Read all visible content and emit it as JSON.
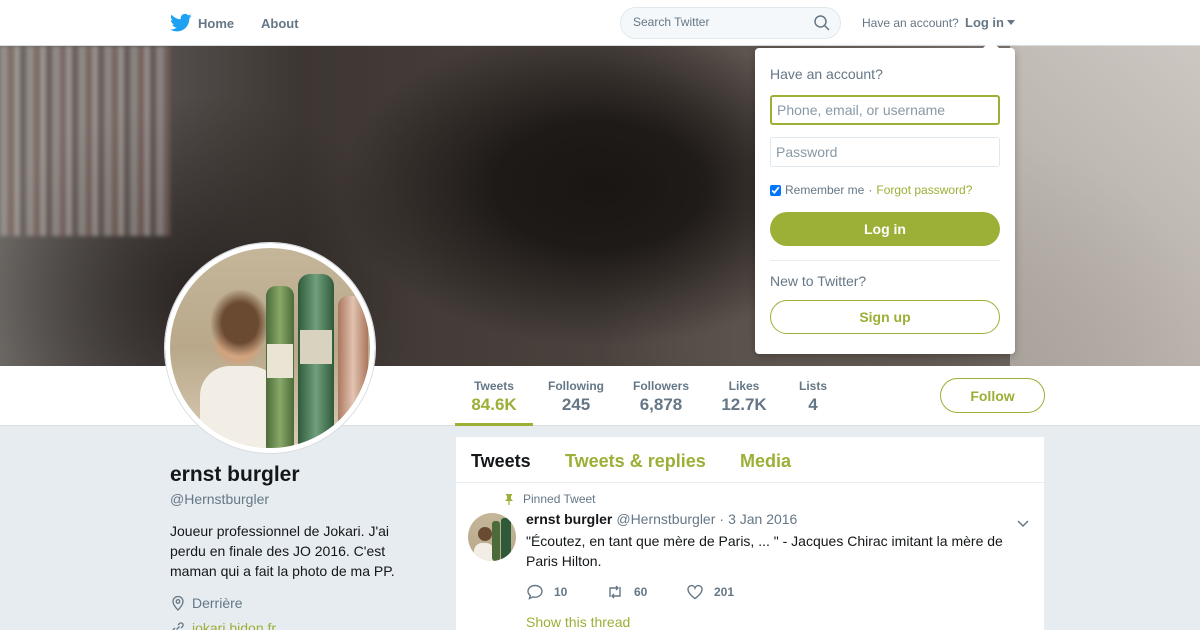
{
  "nav": {
    "home_label": "Home",
    "about_label": "About",
    "search_placeholder": "Search Twitter",
    "have_account": "Have an account?",
    "login_label": "Log in"
  },
  "profile": {
    "name": "ernst burgler",
    "handle": "@Hernstburgler",
    "bio": "Joueur professionnel de Jokari. J'ai perdu en finale des JO 2016. C'est maman qui a fait la photo de ma PP.",
    "location": "Derrière",
    "url": "jokari.bidon.fr"
  },
  "stats": [
    {
      "label": "Tweets",
      "value": "84.6K",
      "active": true
    },
    {
      "label": "Following",
      "value": "245",
      "active": false
    },
    {
      "label": "Followers",
      "value": "6,878",
      "active": false
    },
    {
      "label": "Likes",
      "value": "12.7K",
      "active": false
    },
    {
      "label": "Lists",
      "value": "4",
      "active": false
    }
  ],
  "follow_label": "Follow",
  "timeline": {
    "tabs": [
      {
        "label": "Tweets",
        "active": true
      },
      {
        "label": "Tweets & replies",
        "active": false
      },
      {
        "label": "Media",
        "active": false
      }
    ],
    "tweet": {
      "pinned_label": "Pinned Tweet",
      "name": "ernst burgler",
      "handle": "@Hernstburgler",
      "dot": "·",
      "date": "3 Jan 2016",
      "text": "\"Écoutez, en tant que mère de Paris, ... \" - Jacques Chirac imitant la mère de Paris Hilton.",
      "replies": "10",
      "retweets": "60",
      "likes": "201",
      "show_thread": "Show this thread"
    }
  },
  "login_dropdown": {
    "title": "Have an account?",
    "username_placeholder": "Phone, email, or username",
    "password_placeholder": "Password",
    "remember_label": "Remember me",
    "separator": "·",
    "forgot_label": "Forgot password?",
    "remember_checked": true,
    "login_button": "Log in",
    "new_label": "New to Twitter?",
    "signup_button": "Sign up"
  },
  "colors": {
    "accent": "#9caf36",
    "text_secondary": "#657786",
    "background": "#e6ecf0"
  }
}
